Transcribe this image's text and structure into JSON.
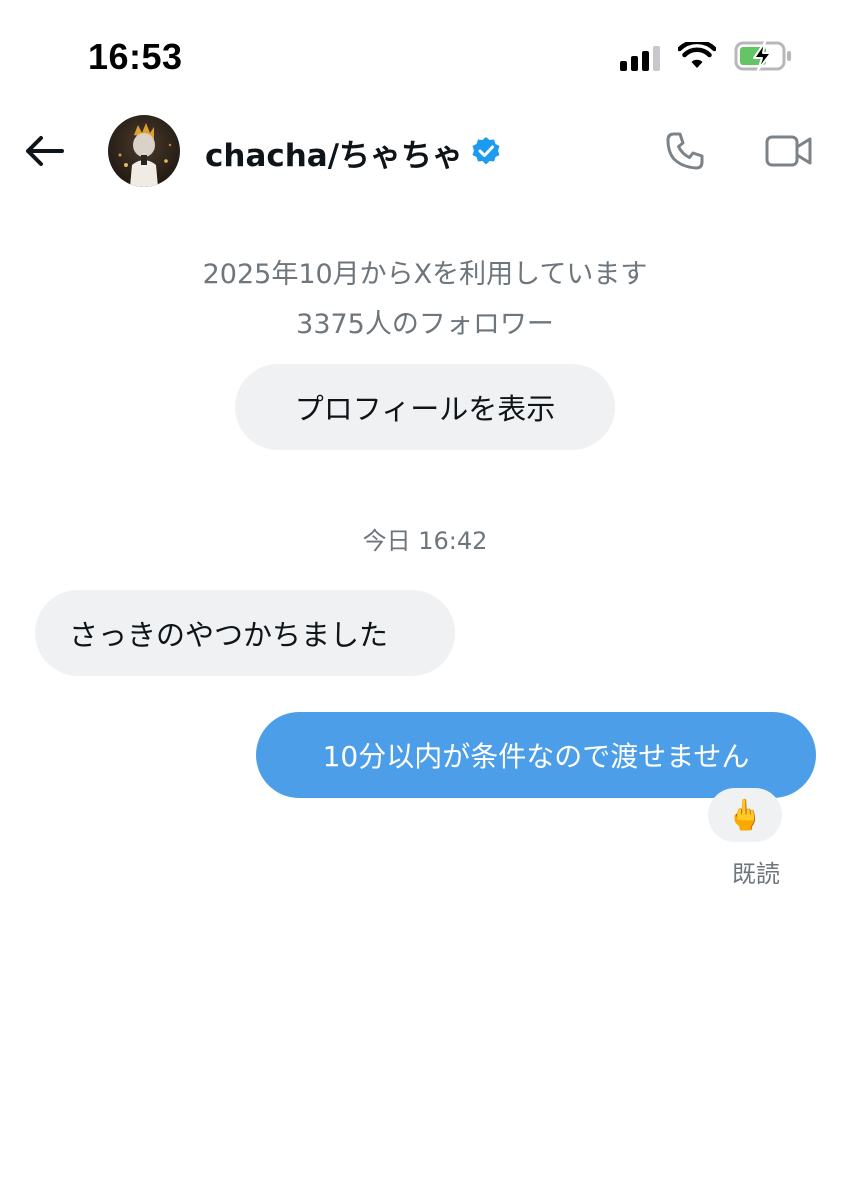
{
  "status_bar": {
    "time": "16:53",
    "battery_color": "#65c466"
  },
  "header": {
    "name": "chacha/ちゃちゃ",
    "verified_color": "#1d9bf0"
  },
  "profile": {
    "joined": "2025年10月からXを利用しています",
    "followers": "3375人のフォロワー",
    "view_profile_label": "プロフィールを表示"
  },
  "conversation": {
    "timestamp": "今日 16:42",
    "messages": [
      {
        "direction": "received",
        "text": "さっきのやつかちました"
      },
      {
        "direction": "sent",
        "text": "10分以内が条件なので渡せません",
        "reaction": "🖕",
        "status": "既読"
      }
    ]
  },
  "colors": {
    "sent_bubble": "#4c9ee9",
    "received_bubble": "#eff1f2",
    "secondary_text": "#6e767d"
  }
}
